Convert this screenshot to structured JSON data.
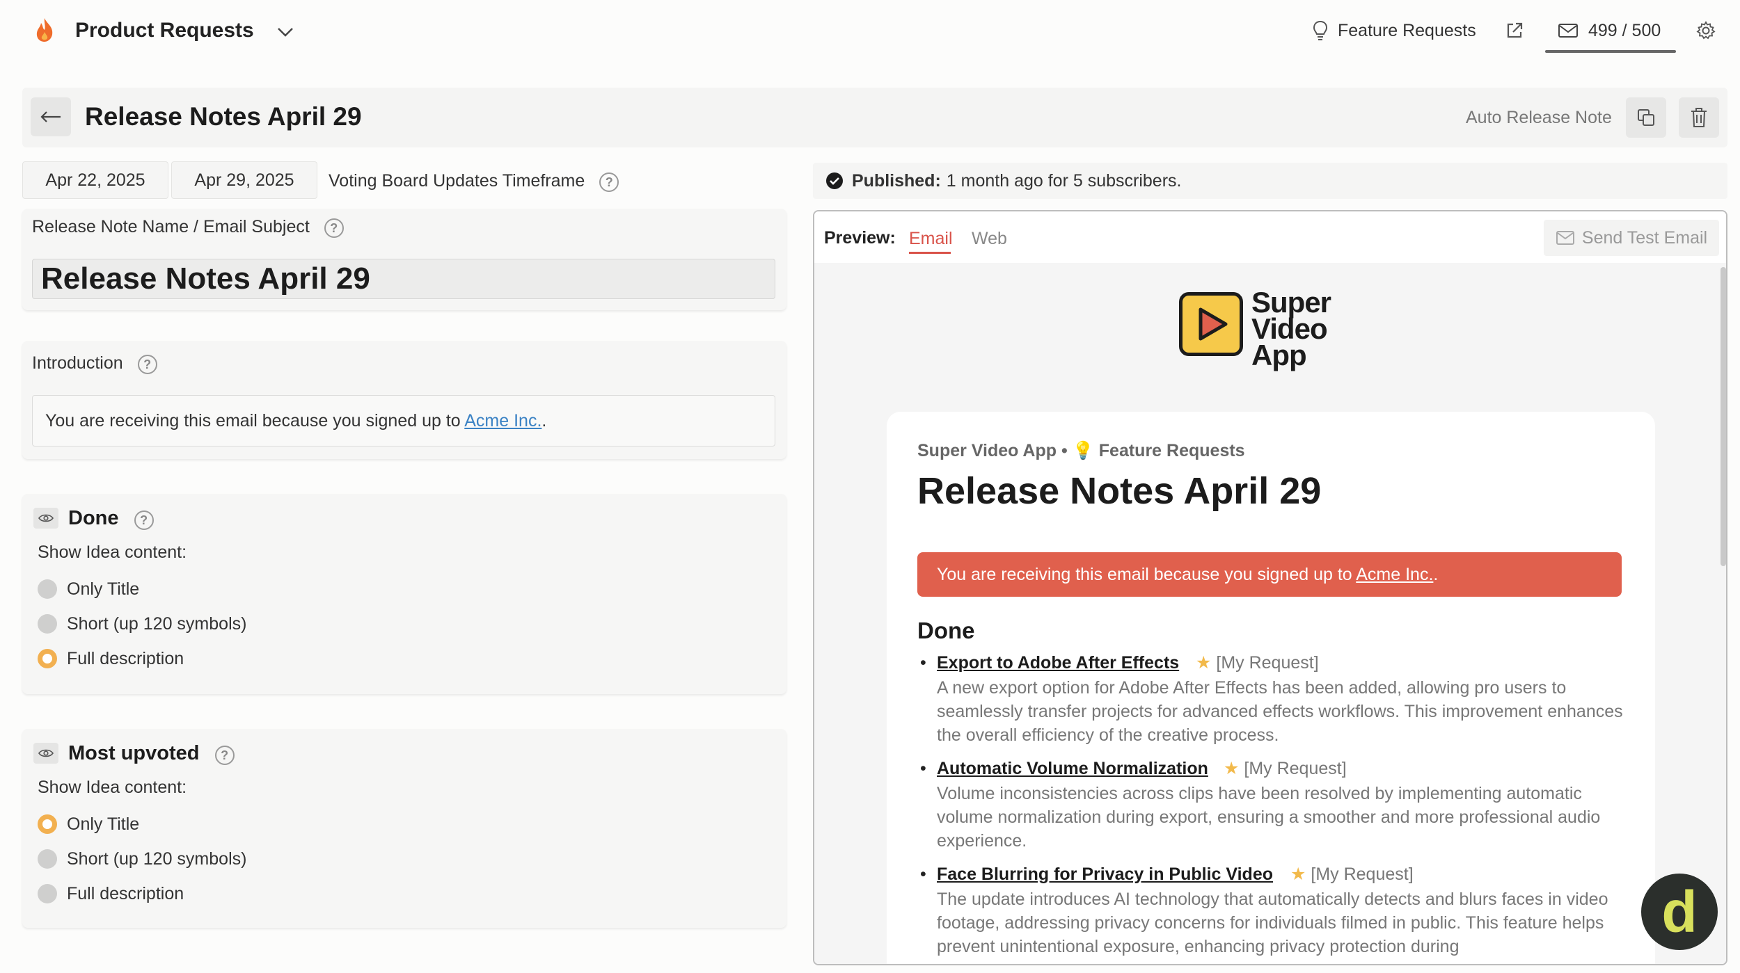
{
  "topbar": {
    "app_title": "Product Requests",
    "feature_requests": "Feature Requests",
    "email_count": "499 / 500"
  },
  "header": {
    "page_title": "Release Notes April 29",
    "auto_release_note": "Auto Release Note"
  },
  "dates": {
    "start": "Apr 22, 2025",
    "end": "Apr 29, 2025",
    "timeframe_label": "Voting Board Updates Timeframe"
  },
  "name_field": {
    "label": "Release Note Name / Email Subject",
    "value": "Release Notes April 29"
  },
  "intro": {
    "label": "Introduction",
    "text_before": "You are receiving this email because you signed up to ",
    "link": "Acme Inc.",
    "text_after": "."
  },
  "sections": [
    {
      "title": "Done",
      "show_label": "Show Idea content:",
      "options": [
        "Only Title",
        "Short (up 120 symbols)",
        "Full description"
      ],
      "selected": "Full description"
    },
    {
      "title": "Most upvoted",
      "show_label": "Show Idea content:",
      "options": [
        "Only Title",
        "Short (up 120 symbols)",
        "Full description"
      ],
      "selected": "Only Title"
    }
  ],
  "published": {
    "label": "Published:",
    "text": "1 month ago for 5 subscribers."
  },
  "preview": {
    "label": "Preview:",
    "tabs": [
      "Email",
      "Web"
    ],
    "active_tab": "Email",
    "send_test": "Send Test Email"
  },
  "email": {
    "logo_lines": [
      "Super",
      "Video",
      "App"
    ],
    "kicker_app": "Super Video App •",
    "kicker_board": "Feature Requests",
    "title": "Release Notes April 29",
    "banner_before": "You are receiving this email because you signed up to ",
    "banner_link": "Acme Inc.",
    "banner_after": ".",
    "section": "Done",
    "items": [
      {
        "title": "Export to Adobe After Effects",
        "tag": "[My Request]",
        "desc": "A new export option for Adobe After Effects has been added, allowing pro users to seamlessly transfer projects for advanced effects workflows. This improvement enhances the overall efficiency of the creative process."
      },
      {
        "title": "Automatic Volume Normalization",
        "tag": "[My Request]",
        "desc": "Volume inconsistencies across clips have been resolved by implementing automatic volume normalization during export, ensuring a smoother and more professional audio experience."
      },
      {
        "title": "Face Blurring for Privacy in Public Video",
        "tag": "[My Request]",
        "desc": "The update introduces AI technology that automatically detects and blurs faces in video footage, addressing privacy concerns for individuals filmed in public. This feature helps prevent unintentional exposure, enhancing privacy protection during"
      }
    ]
  },
  "badge_letter": "d",
  "colors": {
    "accent_red": "#e0604d",
    "radio_selected": "#f2b050",
    "logo_yellow": "#f6c94a"
  }
}
